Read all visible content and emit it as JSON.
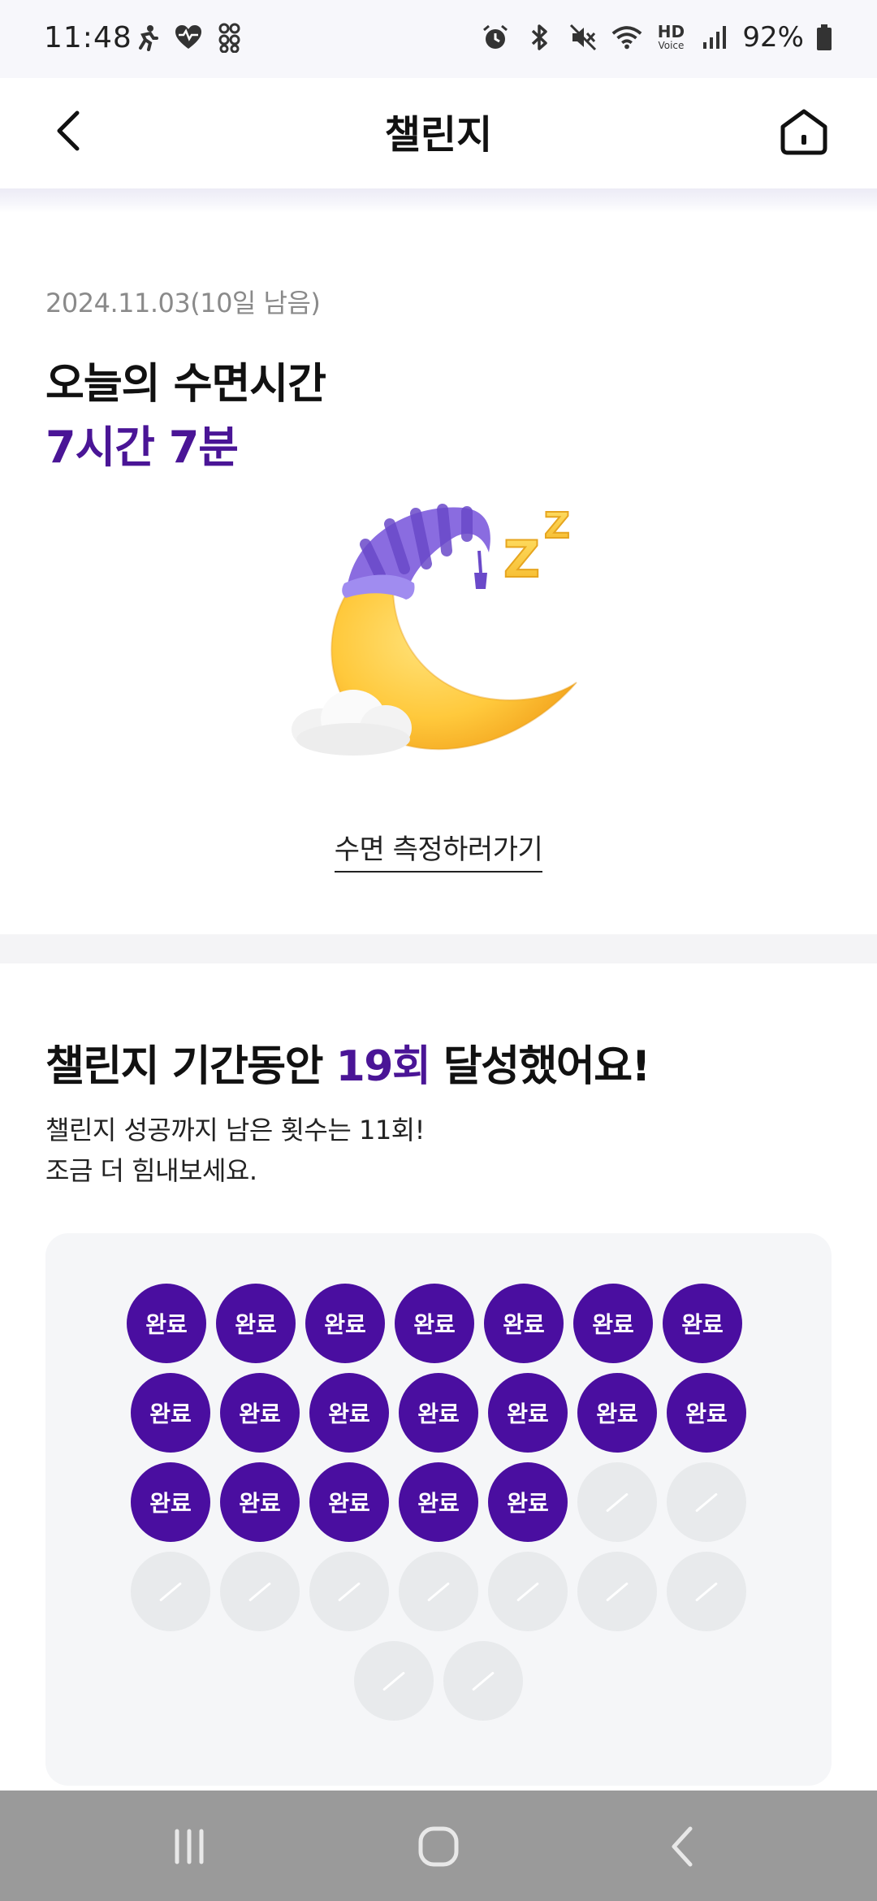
{
  "status_bar": {
    "time": "11:48",
    "battery_percent": "92%",
    "left_icons": [
      "running-icon",
      "heart-icon",
      "apps-icon"
    ],
    "right_icons": [
      "alarm-icon",
      "bluetooth-icon",
      "mute-icon",
      "wifi-icon",
      "hd-voice-icon",
      "signal-icon",
      "battery-icon"
    ],
    "hd_label": "HD",
    "voice_label": "Voice"
  },
  "header": {
    "title": "챌린지",
    "back_icon": "chevron-left-icon",
    "home_icon": "home-icon"
  },
  "sleep_section": {
    "date_text": "2024.11.03(10일 남음)",
    "title": "오늘의 수면시간",
    "value": "7시간 7분",
    "illustration": "sleeping-moon-illustration",
    "zzz_text": "Z Z",
    "measure_link": "수면 측정하러가기"
  },
  "achievement_section": {
    "title_before": "챌린지 기간동안 ",
    "title_count": "19회",
    "title_after": " 달성했어요!",
    "desc_line1": "챌린지 성공까지 남은 횟수는 11회!",
    "desc_line2": "조금 더 힘내보세요.",
    "stamp_label": "완료",
    "completed_count": 19,
    "total_count": 30
  },
  "colors": {
    "accent": "#4a1596",
    "stamp_done": "#4a0ea0",
    "stamp_empty": "#e8eaec",
    "panel_bg": "#f5f6f8",
    "navbar_bg": "#9a9a9a"
  },
  "nav_bar": {
    "icons": [
      "recent-apps-icon",
      "home-circle-icon",
      "back-icon"
    ]
  }
}
